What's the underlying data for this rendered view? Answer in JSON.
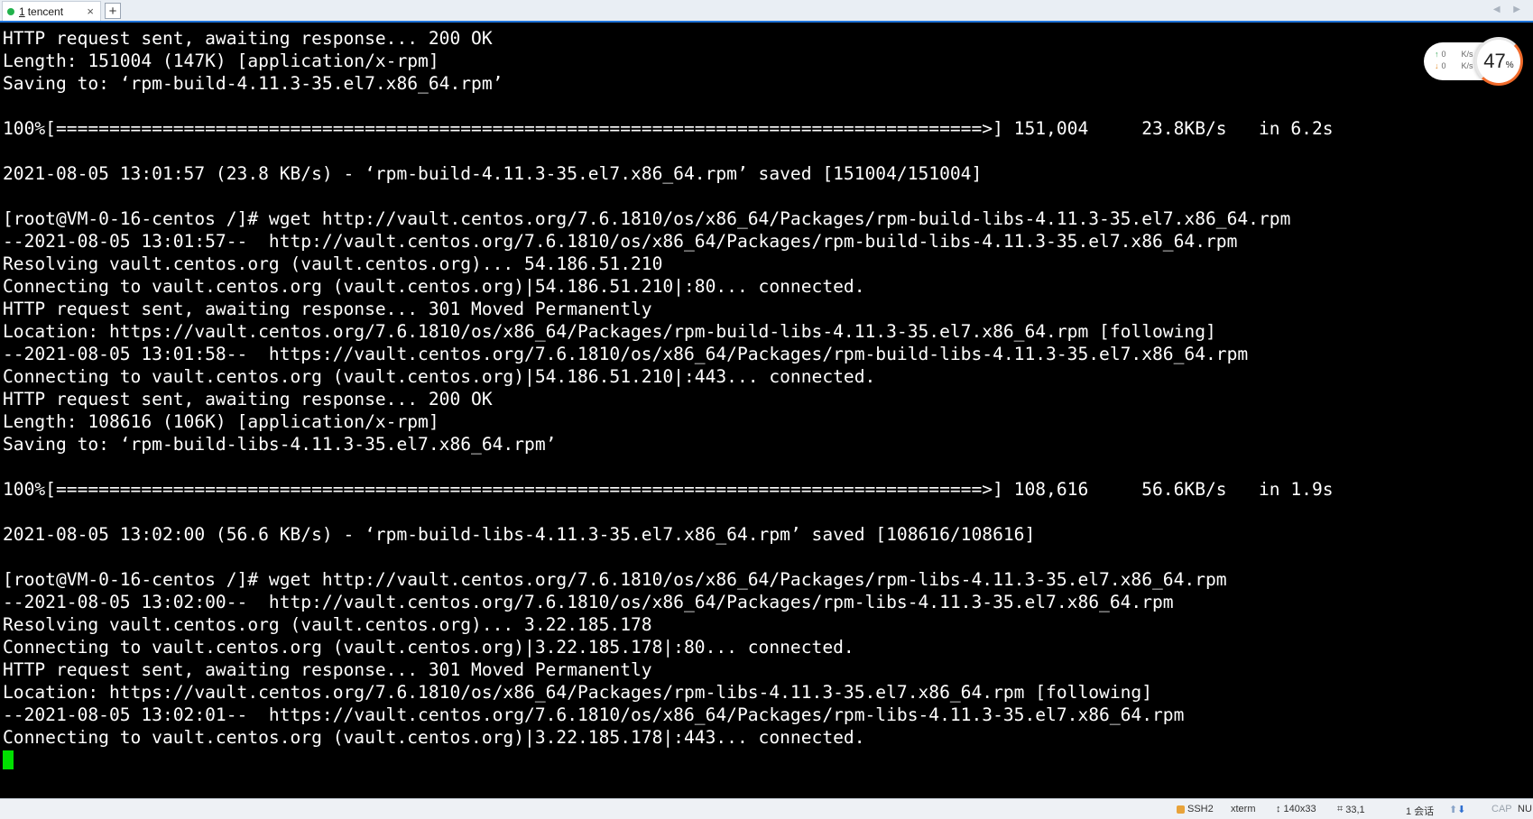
{
  "tab": {
    "number": "1",
    "title": "tencent",
    "close_glyph": "×",
    "add_glyph": "+",
    "nav_glyphs": "◀ ▶"
  },
  "terminal": {
    "lines": [
      "HTTP request sent, awaiting response... 200 OK",
      "Length: 151004 (147K) [application/x-rpm]",
      "Saving to: ‘rpm-build-4.11.3-35.el7.x86_64.rpm’",
      "",
      "100%[=======================================================================================>] 151,004     23.8KB/s   in 6.2s",
      "",
      "2021-08-05 13:01:57 (23.8 KB/s) - ‘rpm-build-4.11.3-35.el7.x86_64.rpm’ saved [151004/151004]",
      "",
      "[root@VM-0-16-centos /]# wget http://vault.centos.org/7.6.1810/os/x86_64/Packages/rpm-build-libs-4.11.3-35.el7.x86_64.rpm",
      "--2021-08-05 13:01:57--  http://vault.centos.org/7.6.1810/os/x86_64/Packages/rpm-build-libs-4.11.3-35.el7.x86_64.rpm",
      "Resolving vault.centos.org (vault.centos.org)... 54.186.51.210",
      "Connecting to vault.centos.org (vault.centos.org)|54.186.51.210|:80... connected.",
      "HTTP request sent, awaiting response... 301 Moved Permanently",
      "Location: https://vault.centos.org/7.6.1810/os/x86_64/Packages/rpm-build-libs-4.11.3-35.el7.x86_64.rpm [following]",
      "--2021-08-05 13:01:58--  https://vault.centos.org/7.6.1810/os/x86_64/Packages/rpm-build-libs-4.11.3-35.el7.x86_64.rpm",
      "Connecting to vault.centos.org (vault.centos.org)|54.186.51.210|:443... connected.",
      "HTTP request sent, awaiting response... 200 OK",
      "Length: 108616 (106K) [application/x-rpm]",
      "Saving to: ‘rpm-build-libs-4.11.3-35.el7.x86_64.rpm’",
      "",
      "100%[=======================================================================================>] 108,616     56.6KB/s   in 1.9s",
      "",
      "2021-08-05 13:02:00 (56.6 KB/s) - ‘rpm-build-libs-4.11.3-35.el7.x86_64.rpm’ saved [108616/108616]",
      "",
      "[root@VM-0-16-centos /]# wget http://vault.centos.org/7.6.1810/os/x86_64/Packages/rpm-libs-4.11.3-35.el7.x86_64.rpm",
      "--2021-08-05 13:02:00--  http://vault.centos.org/7.6.1810/os/x86_64/Packages/rpm-libs-4.11.3-35.el7.x86_64.rpm",
      "Resolving vault.centos.org (vault.centos.org)... 3.22.185.178",
      "Connecting to vault.centos.org (vault.centos.org)|3.22.185.178|:80... connected.",
      "HTTP request sent, awaiting response... 301 Moved Permanently",
      "Location: https://vault.centos.org/7.6.1810/os/x86_64/Packages/rpm-libs-4.11.3-35.el7.x86_64.rpm [following]",
      "--2021-08-05 13:02:01--  https://vault.centos.org/7.6.1810/os/x86_64/Packages/rpm-libs-4.11.3-35.el7.x86_64.rpm",
      "Connecting to vault.centos.org (vault.centos.org)|3.22.185.178|:443... connected."
    ]
  },
  "net_widget": {
    "up_value": "0",
    "up_unit": "K/s",
    "down_value": "0",
    "down_unit": "K/s",
    "cpu_percent": "47",
    "cpu_unit": "%"
  },
  "statusbar": {
    "protocol": "SSH2",
    "terminal_type": "xterm",
    "size": "140x33",
    "cursor_pos": "33,1",
    "sessions": "1 会话",
    "caps": "CAP",
    "num": "NU"
  },
  "colors": {
    "terminal_bg": "#000000",
    "terminal_fg": "#ffffff",
    "cursor": "#00e000",
    "tab_accent": "#1e73d8",
    "cpu_ring": "#f06a2a"
  }
}
